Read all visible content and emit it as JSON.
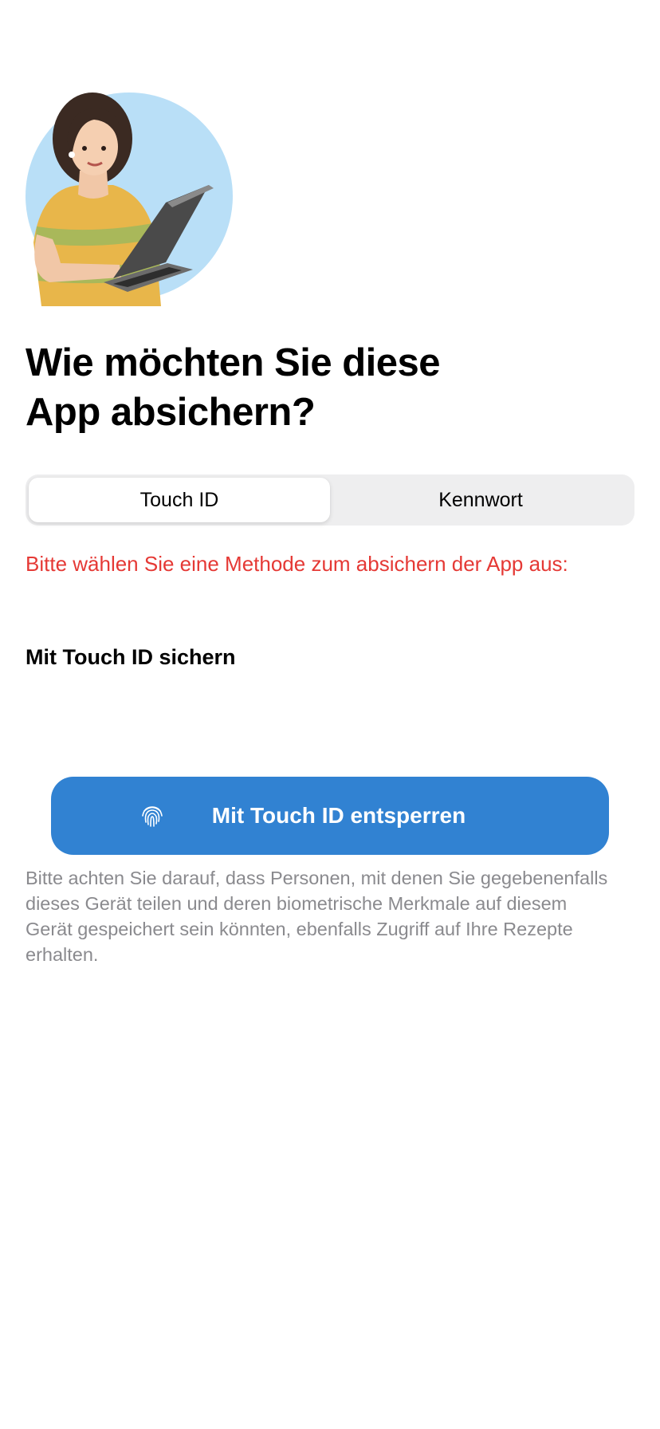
{
  "title": "Wie möchten Sie diese App absichern?",
  "title_line1": "Wie möchten Sie diese",
  "title_line2": "App absichern?",
  "segmented_control": {
    "options": [
      "Touch ID",
      "Kennwort"
    ],
    "selected": "Touch ID"
  },
  "error_message": "Bitte wählen Sie eine Methode zum absichern der App aus:",
  "section_label": "Mit Touch ID sichern",
  "unlock_button": {
    "label": "Mit Touch ID entsperren",
    "icon": "fingerprint-icon"
  },
  "disclaimer": "Bitte achten Sie darauf, dass Personen, mit denen Sie gegebenenfalls dieses Gerät teilen und deren biometrische Merkmale auf diesem Gerät gespeichert sein könnten, ebenfalls Zugriff auf Ihre Rezepte erhalten.",
  "colors": {
    "accent": "#3182d2",
    "error": "#e53935",
    "segment_bg": "#eeeeef",
    "disclaimer": "#8a8a8e"
  }
}
